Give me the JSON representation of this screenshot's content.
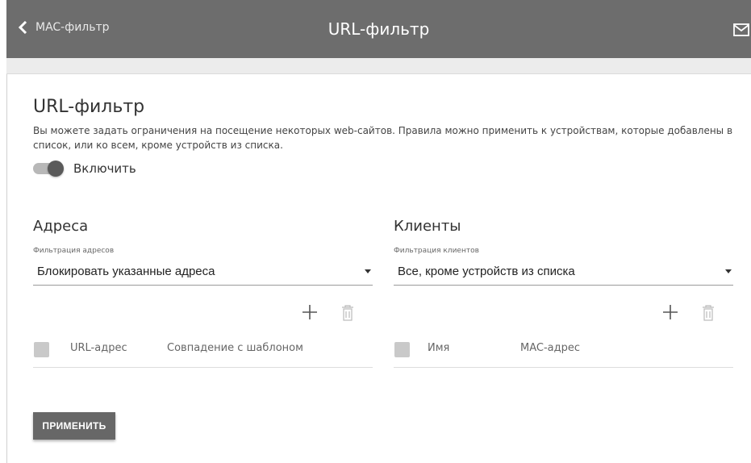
{
  "header": {
    "back_label": "MAC-фильтр",
    "title": "URL-фильтр",
    "mail_icon": "mail-icon"
  },
  "page": {
    "title": "URL-фильтр",
    "description": "Вы можете задать ограничения на посещение некоторых web-сайтов. Правила можно применить к устройствам, которые добавлены в список, или ко всем, кроме устройств из списка.",
    "enable_label": "Включить",
    "enable_on": true
  },
  "addresses": {
    "title": "Адреса",
    "filter_label": "Фильтрация адресов",
    "filter_value": "Блокировать указанные адреса",
    "columns": [
      "URL-адрес",
      "Совпадение с шаблоном"
    ]
  },
  "clients": {
    "title": "Клиенты",
    "filter_label": "Фильтрация клиентов",
    "filter_value": "Все, кроме устройств из списка",
    "columns": [
      "Имя",
      "MAC-адрес"
    ]
  },
  "actions": {
    "apply_label": "ПРИМЕНИТЬ"
  },
  "colors": {
    "header_bg": "#6d6d6d",
    "button_bg": "#676767",
    "checkbox": "#c9c9c9"
  }
}
